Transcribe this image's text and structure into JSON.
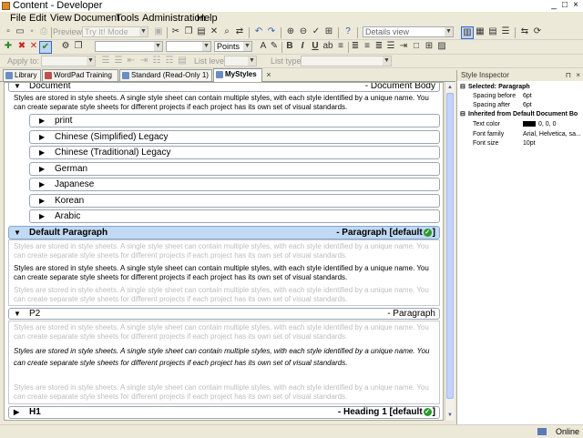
{
  "window": {
    "title": "Content - Developer",
    "controls": [
      "_",
      "□",
      "×"
    ]
  },
  "menu": [
    "File",
    "Edit",
    "View",
    "Document",
    "Tools",
    "Administration",
    "Help"
  ],
  "toolbar1": {
    "preview_label": "Preview",
    "mode_value": "Try It! Mode",
    "view_value": "Details view"
  },
  "toolbar2": {
    "font_size_unit": "Points",
    "format_buttons": [
      "B",
      "I",
      "U"
    ]
  },
  "toolbar3": {
    "apply_to_label": "Apply to:",
    "list_level_label": "List level:",
    "list_type_label": "List type:"
  },
  "tabs": [
    {
      "label": "Library",
      "color": "#6c8cc4"
    },
    {
      "label": "WordPad Training",
      "color": "#c0504d"
    },
    {
      "label": "Standard (Read-Only 1)",
      "color": "#6c8cc4"
    },
    {
      "label": "MyStyles",
      "color": "#6c8cc4",
      "active": true
    }
  ],
  "styles": {
    "document": {
      "name": "Document",
      "type": "- Document Body"
    },
    "intro_text": "Styles are stored in style sheets. A single style sheet can contain multiple styles, with each style identified by a unique name. You can create separate style sheets for different projects if each project has its own set of visual standards.",
    "languages": [
      "print",
      "Chinese (Simplified) Legacy",
      "Chinese (Traditional) Legacy",
      "German",
      "Japanese",
      "Korean",
      "Arabic"
    ],
    "default_paragraph": {
      "name": "Default Paragraph",
      "type": "- Paragraph [default",
      "suffix": "]"
    },
    "p2": {
      "name": "P2",
      "type": "- Paragraph"
    },
    "h1": {
      "name": "H1",
      "type": "- Heading 1 [default",
      "suffix": "]"
    }
  },
  "inspector": {
    "title": "Style Inspector",
    "controls": [
      "⊓",
      "×"
    ],
    "selected_heading": "Selected: Paragraph",
    "selected_props": [
      {
        "k": "Spacing before",
        "v": "6pt"
      },
      {
        "k": "Spacing after",
        "v": "6pt"
      }
    ],
    "inherited_heading": "Inherited from Default Document Bo",
    "inherited_props": [
      {
        "k": "Text color",
        "v": "0, 0, 0",
        "swatch": "#000000"
      },
      {
        "k": "Font family",
        "v": "Arial, Helvetica, sa..."
      },
      {
        "k": "Font size",
        "v": "10pt"
      }
    ]
  },
  "status": {
    "text": "Online"
  }
}
